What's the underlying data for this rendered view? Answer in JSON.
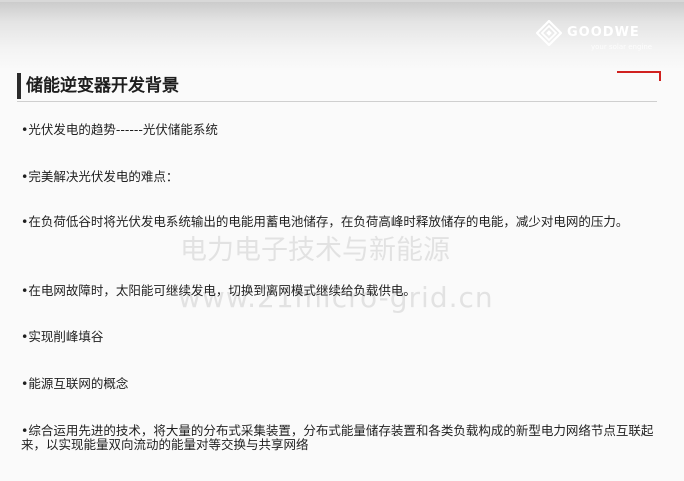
{
  "brand": {
    "name": "GOODWE",
    "tagline": "your solar engine"
  },
  "header": {
    "title": "储能逆变器开发背景"
  },
  "watermark": {
    "line1": "电力电子技术与新能源",
    "line2": "www.21micro-grid.cn"
  },
  "bullets": [
    {
      "text": "•光伏发电的趋势------光伏储能系统"
    },
    {
      "text": "•完美解决光伏发电的难点："
    },
    {
      "text": "•在负荷低谷时将光伏发电系统输出的电能用蓄电池储存，在负荷高峰时释放储存的电能，减少对电网的压力。"
    },
    {
      "text": "•在电网故障时，太阳能可继续发电，切换到离网模式继续给负载供电。"
    },
    {
      "text": "•实现削峰填谷"
    },
    {
      "text": "•能源互联网的概念"
    },
    {
      "text": "•综合运用先进的技术，将大量的分布式采集装置，分布式能量储存装置和各类负载构成的新型电力网络节点互联起来，以实现能量双向流动的能量对等交换与共享网络"
    }
  ],
  "colors": {
    "accent": "#d0211f",
    "title": "#1e1e1e",
    "text": "#1f1f1f"
  }
}
